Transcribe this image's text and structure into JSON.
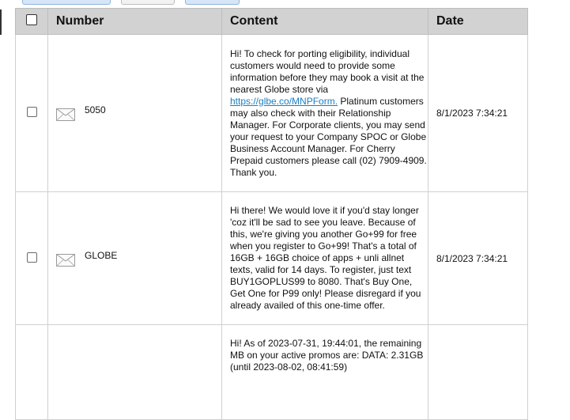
{
  "table": {
    "headers": {
      "number": "Number",
      "content": "Content",
      "date": "Date"
    },
    "rows": [
      {
        "number": "5050",
        "content_before": "Hi! To check for porting eligibility, individual customers would need to provide some information before they may book a visit at the nearest Globe store via ",
        "link": "https://glbe.co/MNPForm.",
        "content_after": " Platinum customers may also check with their Relationship Manager. For Corporate clients, you may send your request to your Company SPOC or Globe Business Account Manager. For Cherry Prepaid customers please call (02) 7909-4909. Thank you.",
        "date": "8/1/2023 7:34:21"
      },
      {
        "number": "GLOBE",
        "content": "Hi there! We would love it if you'd stay longer 'coz it'll be sad to see you leave. Because of this, we're giving you another Go+99 for free when you register to Go+99! That's a total of 16GB + 16GB choice of apps + unli allnet texts, valid for 14 days. To register, just text BUY1GOPLUS99 to 8080. That's Buy One, Get One for P99 only! Please disregard if you already availed of this one-time offer.",
        "date": "8/1/2023 7:34:21"
      },
      {
        "number": "",
        "content": "Hi! As of 2023-07-31, 19:44:01, the remaining MB on your active promos are: DATA: 2.31GB (until 2023-08-02, 08:41:59)",
        "date": ""
      }
    ]
  },
  "icons": {
    "message": "envelope-icon"
  },
  "colors": {
    "header_bg": "#d2d2d2",
    "link": "#1a7fc1",
    "border": "#d0d0d0"
  }
}
